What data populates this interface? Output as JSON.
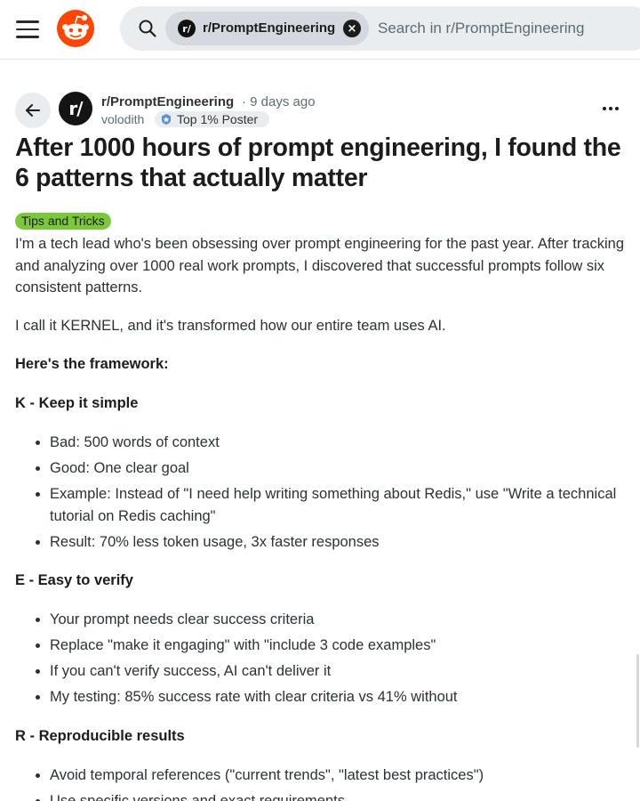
{
  "search": {
    "community_chip": "r/PromptEngineering",
    "chip_avatar_text": "r/",
    "placeholder": "Search in r/PromptEngineering"
  },
  "post": {
    "subreddit": "r/PromptEngineering",
    "subreddit_avatar_text": "r/",
    "time": "· 9 days ago",
    "author": "volodith",
    "author_badge": "Top 1% Poster",
    "title": "After 1000 hours of prompt engineering, I found the 6 patterns that actually matter",
    "flair": "Tips and Tricks",
    "flair_color": "#7bc83c",
    "intro": "I'm a tech lead who's been obsessing over prompt engineering for the past year. After tracking and analyzing over 1000 real work prompts, I discovered that successful prompts follow six consistent patterns.",
    "kernel_line": "I call it KERNEL, and it's transformed how our entire team uses AI.",
    "framework_heading": "Here's the framework:",
    "sections": [
      {
        "heading": "K - Keep it simple",
        "bullets": [
          "Bad: 500 words of context",
          "Good: One clear goal",
          "Example: Instead of \"I need help writing something about Redis,\" use \"Write a technical tutorial on Redis caching\"",
          "Result: 70% less token usage, 3x faster responses"
        ]
      },
      {
        "heading": "E - Easy to verify",
        "bullets": [
          "Your prompt needs clear success criteria",
          "Replace \"make it engaging\" with \"include 3 code examples\"",
          "If you can't verify success, AI can't deliver it",
          "My testing: 85% success rate with clear criteria vs 41% without"
        ]
      },
      {
        "heading": "R - Reproducible results",
        "bullets": [
          "Avoid temporal references (\"current trends\", \"latest best practices\")",
          "Use specific versions and exact requirements"
        ]
      }
    ]
  },
  "icons": {
    "menu": "hamburger-menu-icon",
    "logo": "reddit-logo",
    "search": "search-icon",
    "close": "close-icon",
    "back": "arrow-left-icon",
    "more": "more-options-icon",
    "badge": "top-poster-icon"
  },
  "colors": {
    "brand": "#ff4500",
    "search_bg": "#eaedef",
    "chip_bg": "#d3d9de"
  }
}
